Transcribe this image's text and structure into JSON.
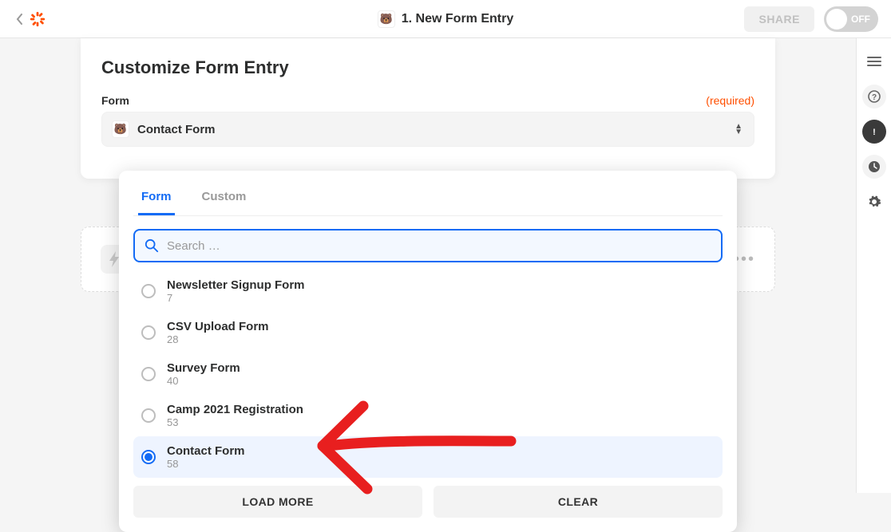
{
  "header": {
    "step_number": "1.",
    "step_title": "New Form Entry",
    "share": "SHARE",
    "toggle": "OFF"
  },
  "card": {
    "title": "Customize Form Entry",
    "field_label": "Form",
    "required": "(required)",
    "selected_value": "Contact Form"
  },
  "dropdown": {
    "tabs": {
      "form": "Form",
      "custom": "Custom",
      "active": 0
    },
    "search_placeholder": "Search …",
    "options": [
      {
        "name": "Newsletter Signup Form",
        "id": "7",
        "selected": false
      },
      {
        "name": "CSV Upload Form",
        "id": "28",
        "selected": false
      },
      {
        "name": "Survey Form",
        "id": "40",
        "selected": false
      },
      {
        "name": "Camp 2021 Registration",
        "id": "53",
        "selected": false
      },
      {
        "name": "Contact Form",
        "id": "58",
        "selected": true
      }
    ],
    "load_more": "LOAD MORE",
    "clear": "CLEAR"
  },
  "rail": {
    "items": [
      "lines",
      "help",
      "alert",
      "history",
      "settings"
    ]
  }
}
